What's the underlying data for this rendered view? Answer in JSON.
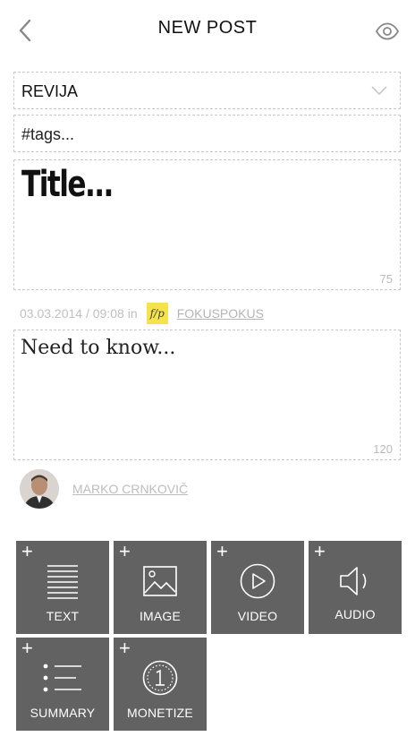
{
  "header": {
    "title": "NEW POST",
    "back_icon": "chevron-left-icon",
    "preview_icon": "eye-icon"
  },
  "form": {
    "category": {
      "value": "REVIJA",
      "icon": "chevron-down-icon"
    },
    "tags": {
      "placeholder": "#tags..."
    },
    "title": {
      "placeholder": "Title...",
      "counter": "75"
    },
    "meta": {
      "date": "03.03.2014 / 09:08",
      "in_label": "in",
      "brand_logo_text": "f/p",
      "brand": "FOKUSPOKUS",
      "brand_logo_color": "#f6e24a"
    },
    "lead": {
      "placeholder": "Need to know...",
      "counter": "120"
    }
  },
  "author": {
    "name": "MARKO CRNKOVIČ"
  },
  "blocks": {
    "plus": "+",
    "text": {
      "label": "TEXT",
      "icon": "text-lines-icon"
    },
    "image": {
      "label": "IMAGE",
      "icon": "image-icon"
    },
    "video": {
      "label": "VIDEO",
      "icon": "play-circle-icon"
    },
    "audio": {
      "label": "AUDIO",
      "icon": "speaker-icon"
    },
    "summary": {
      "label": "SUMMARY",
      "icon": "bullet-list-icon"
    },
    "monetize": {
      "label": "MONETIZE",
      "icon": "coin-icon"
    }
  },
  "colors": {
    "tile_bg": "#626262",
    "dashed_border": "#c9c9c9",
    "muted_text": "#c0c0c0"
  }
}
